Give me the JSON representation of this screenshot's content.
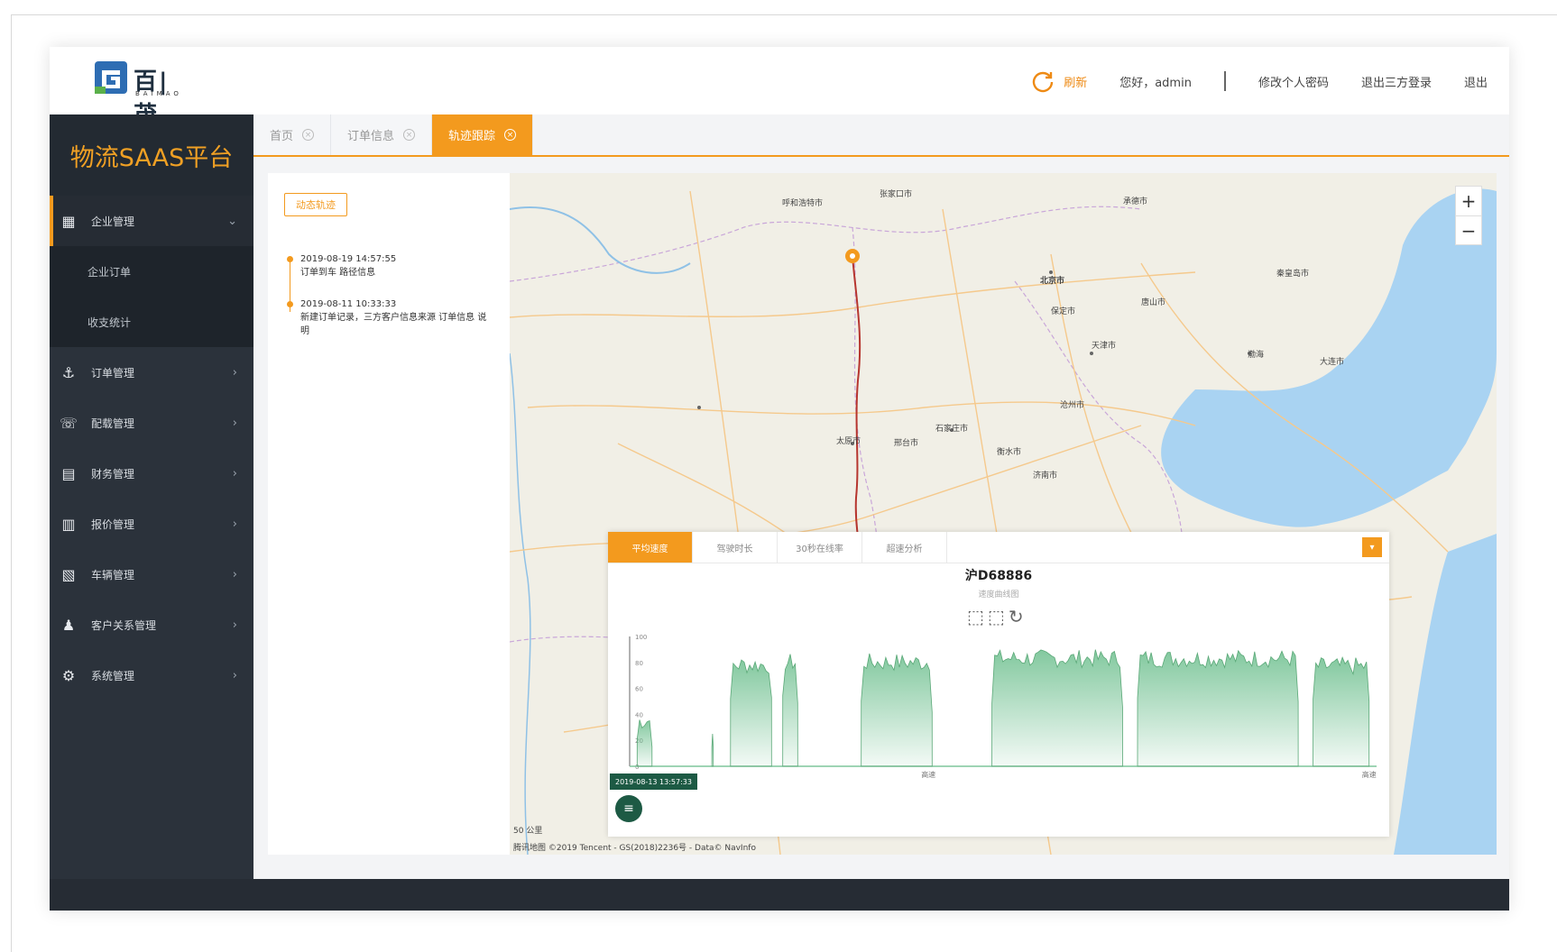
{
  "header": {
    "logo_text": "百|茂",
    "logo_sub": "BAIMAO",
    "refresh_label": "刷新",
    "greeting": "您好，admin",
    "change_password": "修改个人密码",
    "third_party": "退出三方登录",
    "logout": "退出"
  },
  "sidebar": {
    "brand": "物流SAAS平台",
    "items": [
      {
        "label": "企业管理",
        "icon": "building-icon",
        "arrow": "⌄",
        "active": true
      },
      {
        "label": "订单管理",
        "icon": "order-icon",
        "arrow": "›"
      },
      {
        "label": "配载管理",
        "icon": "dispatch-icon",
        "arrow": "›"
      },
      {
        "label": "财务管理",
        "icon": "finance-icon",
        "arrow": "›"
      },
      {
        "label": "报价管理",
        "icon": "quote-icon",
        "arrow": "›"
      },
      {
        "label": "车辆管理",
        "icon": "vehicle-icon",
        "arrow": "›"
      },
      {
        "label": "客户关系管理",
        "icon": "customer-icon",
        "arrow": "›"
      },
      {
        "label": "系统管理",
        "icon": "gear-icon",
        "arrow": "›"
      }
    ],
    "subitems": [
      "企业订单",
      "收支统计"
    ]
  },
  "tabs": [
    {
      "label": "首页"
    },
    {
      "label": "订单信息"
    },
    {
      "label": "轨迹跟踪",
      "active": true
    }
  ],
  "track": {
    "button": "动态轨迹",
    "events": [
      {
        "time": "2019-08-19 14:57:55",
        "text": "订单到车 路径信息"
      },
      {
        "time": "2019-08-11 10:33:33",
        "text": "新建订单记录，三方客户信息来源 订单信息 说明"
      }
    ]
  },
  "map": {
    "labels": [
      {
        "text": "呼和浩特市"
      },
      {
        "text": "北京市"
      },
      {
        "text": "天津市"
      },
      {
        "text": "石家庄市"
      },
      {
        "text": "太原市"
      },
      {
        "text": "大连市"
      },
      {
        "text": "渤海"
      },
      {
        "text": "承德市"
      },
      {
        "text": "张家口市"
      },
      {
        "text": "唐山市"
      },
      {
        "text": "秦皇岛市"
      },
      {
        "text": "保定市"
      },
      {
        "text": "沧州市"
      },
      {
        "text": "衡水市"
      },
      {
        "text": "邢台市"
      },
      {
        "text": "济南市"
      }
    ],
    "credit": "腾讯地图 ©2019 Tencent - GS(2018)2236号 - Data© NavInfo",
    "scale": "50 公里",
    "zoom_in": "+",
    "zoom_out": "−"
  },
  "popup": {
    "tabs": [
      "平均速度",
      "驾驶时长",
      "30秒在线率",
      "超速分析"
    ],
    "plate": "沪D68886",
    "subtitle": "速度曲线图",
    "collapse": "▾",
    "timestamp": "2019-08-13 13:57:33",
    "play": "≡"
  },
  "chart_data": {
    "type": "area",
    "yticks": [
      "100",
      "80",
      "60",
      "40",
      "20",
      "0"
    ],
    "ylim": [
      0,
      100
    ],
    "xtick_labels": [
      "高速",
      "高速"
    ],
    "color": "#6dbf8e",
    "segments": [
      {
        "start": 0.01,
        "end": 0.03,
        "level": 35
      },
      {
        "start": 0.11,
        "end": 0.112,
        "level": 25
      },
      {
        "start": 0.135,
        "end": 0.19,
        "level": 78
      },
      {
        "start": 0.205,
        "end": 0.225,
        "level": 80
      },
      {
        "start": 0.31,
        "end": 0.405,
        "level": 80
      },
      {
        "start": 0.485,
        "end": 0.66,
        "level": 83
      },
      {
        "start": 0.68,
        "end": 0.895,
        "level": 83
      },
      {
        "start": 0.915,
        "end": 0.99,
        "level": 77
      }
    ]
  }
}
